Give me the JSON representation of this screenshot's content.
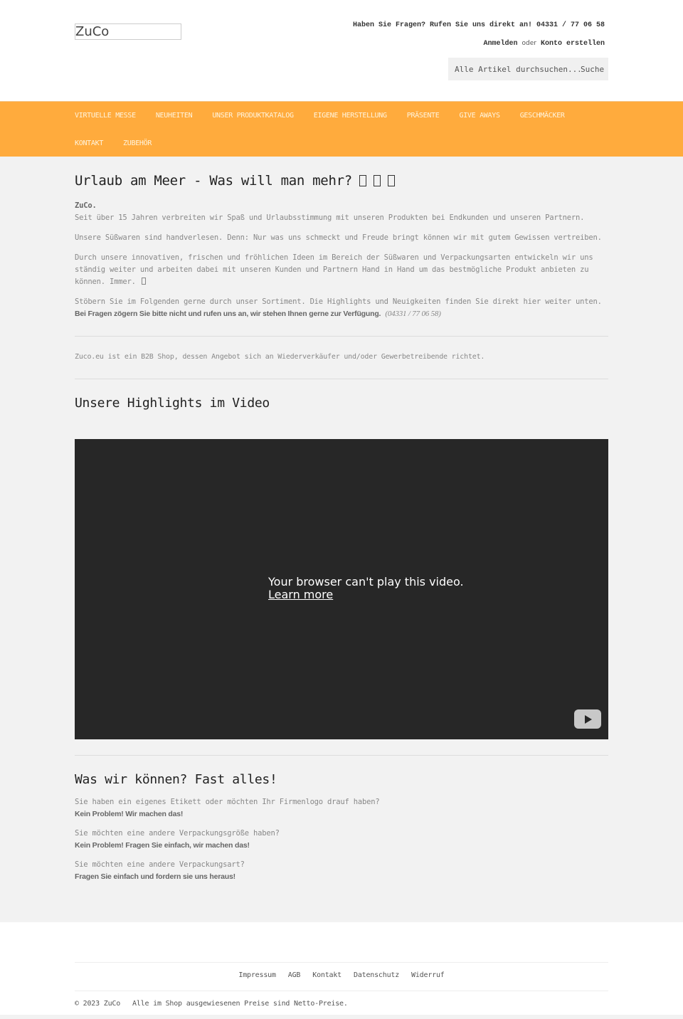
{
  "header": {
    "logo": "ZuCo",
    "hotline": "Haben Sie Fragen? Rufen Sie uns direkt an! 04331 / 77 06 58",
    "login_label": "Anmelden",
    "or_label": "oder",
    "register_label": "Konto erstellen",
    "search_placeholder": "Alle Artikel durchsuchen...",
    "search_button": "Suche"
  },
  "nav": {
    "row1": [
      "Virtuelle Messe",
      "Neuheiten",
      "Unser Produktkatalog",
      "Eigene Herstellung",
      "Präsente",
      "Give Aways",
      "Geschmäcker"
    ],
    "row2": [
      "Kontakt",
      "Zubehör"
    ]
  },
  "colors": {
    "nav_bg": "#ffab3d",
    "nav_text": "#fff4de",
    "page_bg": "#f2f2f2",
    "video_bg": "#272727"
  },
  "intro": {
    "title": "Urlaub am Meer - Was will man mehr?",
    "brand": "ZuCo.",
    "p1": "Seit über 15 Jahren verbreiten wir Spaß und Urlaubsstimmung mit unseren Produkten bei Endkunden und unseren Partnern.",
    "p2": "Unsere Süßwaren sind handverlesen. Denn: Nur was uns schmeckt und Freude bringt können wir mit gutem Gewissen vertreiben.",
    "p3": "Durch unsere innovativen, frischen und fröhlichen Ideen im Bereich der Süßwaren und Verpackungsarten entwickeln wir uns ständig weiter und arbeiten dabei mit unseren Kunden und Partnern Hand in Hand um das bestmögliche Produkt anbieten zu können. Immer.",
    "p4": "Stöbern Sie im Folgenden gerne durch unser Sortiment. Die Highlights und Neuigkeiten finden Sie direkt hier weiter unten.",
    "p4_bold": "Bei Fragen zögern Sie bitte nicht und rufen uns an, wir stehen Ihnen gerne zur Verfügung.",
    "p4_phone": "(04331 / 77 06 58)"
  },
  "b2b_notice": "Zuco.eu ist ein B2B Shop, dessen Angebot sich an Wiederverkäufer und/oder Gewerbetreibende richtet.",
  "video_section": {
    "title": "Unsere Highlights im Video",
    "error_message": "Your browser can't play this video.",
    "learn_more": "Learn more"
  },
  "capabilities": {
    "title": "Was wir können? Fast alles!",
    "items": [
      {
        "question": "Sie haben ein eigenes Etikett oder möchten Ihr Firmenlogo drauf haben?",
        "answer": "Kein Problem! Wir machen das!"
      },
      {
        "question": "Sie möchten eine andere Verpackungsgröße haben?",
        "answer": "Kein Problem! Fragen Sie einfach, wir machen das!"
      },
      {
        "question": "Sie möchten eine andere Verpackungsart?",
        "answer": "Fragen Sie einfach und fordern sie uns heraus!"
      }
    ]
  },
  "footer": {
    "links": [
      "Impressum",
      "AGB",
      "Kontakt",
      "Datenschutz",
      "Widerruf"
    ],
    "copyright": "© 2023 ZuCo",
    "price_note": "Alle im Shop ausgewiesenen Preise sind Netto-Preise."
  }
}
